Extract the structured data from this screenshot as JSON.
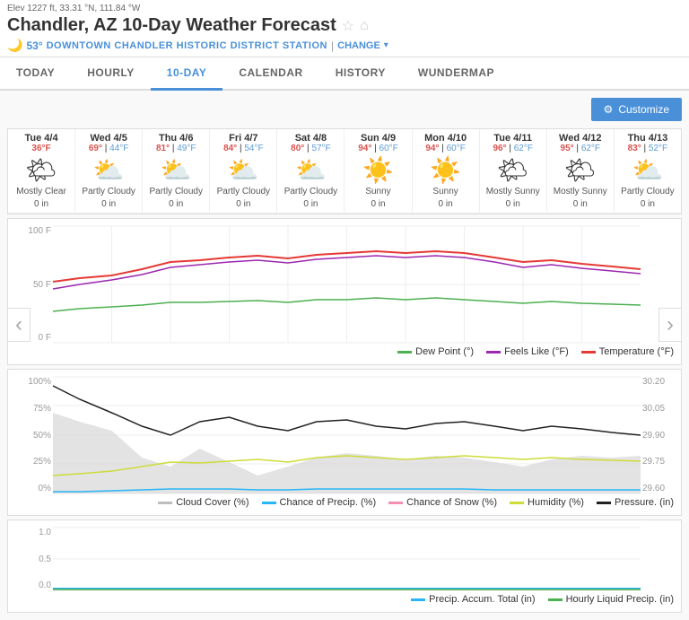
{
  "elevation": "Elev 1227 ft, 33.31 °N, 111.84 °W",
  "title": "Chandler, AZ 10-Day Weather Forecast",
  "temp": "53°",
  "station": "DOWNTOWN CHANDLER HISTORIC DISTRICT STATION",
  "change_label": "CHANGE",
  "tabs": [
    {
      "label": "TODAY",
      "active": false
    },
    {
      "label": "HOURLY",
      "active": false
    },
    {
      "label": "10-DAY",
      "active": true
    },
    {
      "label": "CALENDAR",
      "active": false
    },
    {
      "label": "HISTORY",
      "active": false
    },
    {
      "label": "WUNDERMAP",
      "active": false
    }
  ],
  "customize_label": "Customize",
  "days": [
    {
      "date": "Tue 4/4",
      "high": "36°F",
      "low": "",
      "condition": "Mostly Clear",
      "precip": "0 in",
      "icon": "🌤"
    },
    {
      "date": "Wed 4/5",
      "high": "69°",
      "low": "44°F",
      "condition": "Partly Cloudy",
      "precip": "0 in",
      "icon": "⛅"
    },
    {
      "date": "Thu 4/6",
      "high": "81°",
      "low": "49°F",
      "condition": "Partly Cloudy",
      "precip": "0 in",
      "icon": "⛅"
    },
    {
      "date": "Fri 4/7",
      "high": "84°",
      "low": "54°F",
      "condition": "Partly Cloudy",
      "precip": "0 in",
      "icon": "⛅"
    },
    {
      "date": "Sat 4/8",
      "high": "80°",
      "low": "57°F",
      "condition": "Partly Cloudy",
      "precip": "0 in",
      "icon": "⛅"
    },
    {
      "date": "Sun 4/9",
      "high": "94°",
      "low": "60°F",
      "condition": "Sunny",
      "precip": "0 in",
      "icon": "☀️"
    },
    {
      "date": "Mon 4/10",
      "high": "94°",
      "low": "60°F",
      "condition": "Sunny",
      "precip": "0 in",
      "icon": "☀️"
    },
    {
      "date": "Tue 4/11",
      "high": "96°",
      "low": "62°F",
      "condition": "Mostly Sunny",
      "precip": "0 in",
      "icon": "🌤"
    },
    {
      "date": "Wed 4/12",
      "high": "95°",
      "low": "62°F",
      "condition": "Mostly Sunny",
      "precip": "0 in",
      "icon": "🌤"
    },
    {
      "date": "Thu 4/13",
      "high": "83°",
      "low": "52°F",
      "condition": "Partly Cloudy",
      "precip": "0 in",
      "icon": "⛅"
    }
  ],
  "chart1": {
    "y_labels": [
      "100 F",
      "50 F",
      "0 F"
    ],
    "legend": [
      {
        "label": "Dew Point (°)",
        "color": "#4caf50"
      },
      {
        "label": "Feels Like (°F)",
        "color": "#9c27b0"
      },
      {
        "label": "Temperature (°F)",
        "color": "#e53935"
      }
    ]
  },
  "chart2": {
    "y_labels": [
      "100%",
      "75%",
      "50%",
      "25%",
      "0%"
    ],
    "y_labels_right": [
      "30.20",
      "30.05",
      "29.90",
      "29.75",
      "29.60"
    ],
    "legend": [
      {
        "label": "Cloud Cover (%)",
        "color": "#bdbdbd"
      },
      {
        "label": "Chance of Precip. (%)",
        "color": "#29b6f6"
      },
      {
        "label": "Chance of Snow (%)",
        "color": "#f48fb1"
      },
      {
        "label": "Humidity (%)",
        "color": "#cddc39"
      },
      {
        "label": "Pressure. (in)",
        "color": "#212121"
      }
    ]
  },
  "chart3": {
    "y_labels": [
      "1.0",
      "0.5",
      "0.0"
    ],
    "legend": [
      {
        "label": "Precip. Accum. Total (in)",
        "color": "#29b6f6"
      },
      {
        "label": "Hourly Liquid Precip. (in)",
        "color": "#4caf50"
      }
    ]
  }
}
